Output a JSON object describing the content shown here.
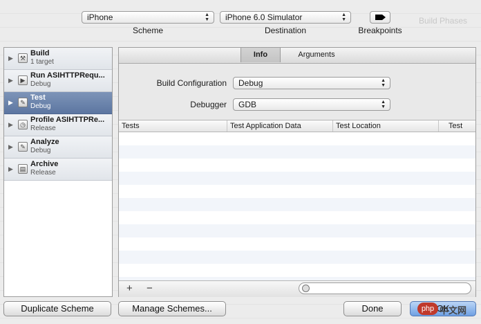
{
  "window": {
    "background_ghost_text": "Build Phases"
  },
  "toolbar": {
    "scheme_value": "iPhone",
    "scheme_caption": "Scheme",
    "destination_value": "iPhone 6.0 Simulator",
    "destination_caption": "Destination",
    "breakpoints_caption": "Breakpoints"
  },
  "sidebar": {
    "items": [
      {
        "name": "Build",
        "sub": "1 target",
        "icon": "hammer-icon"
      },
      {
        "name": "Run ASIHTTPRequ...",
        "sub": "Debug",
        "icon": "run-icon"
      },
      {
        "name": "Test",
        "sub": "Debug",
        "icon": "wrench-icon"
      },
      {
        "name": "Profile ASIHTTPRe...",
        "sub": "Release",
        "icon": "profile-icon"
      },
      {
        "name": "Analyze",
        "sub": "Debug",
        "icon": "analyze-icon"
      },
      {
        "name": "Archive",
        "sub": "Release",
        "icon": "archive-icon"
      }
    ]
  },
  "tabs": [
    {
      "label": "Info"
    },
    {
      "label": "Arguments"
    }
  ],
  "form": {
    "build_config_label": "Build Configuration",
    "build_config_value": "Debug",
    "debugger_label": "Debugger",
    "debugger_value": "GDB"
  },
  "table": {
    "columns": [
      "Tests",
      "Test Application Data",
      "Test Location",
      "Test"
    ]
  },
  "footer": {
    "add": "+",
    "remove": "−"
  },
  "buttons": {
    "duplicate": "Duplicate Scheme",
    "manage": "Manage Schemes...",
    "done": "Done",
    "ok": "OK"
  },
  "watermark": {
    "badge": "php",
    "text": "中文网"
  }
}
